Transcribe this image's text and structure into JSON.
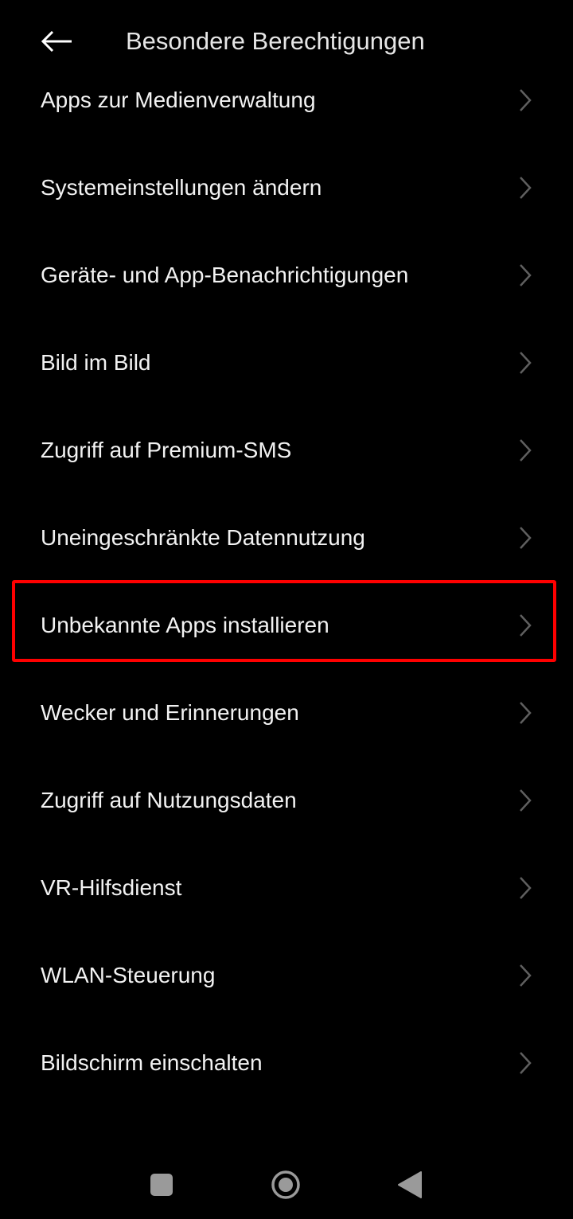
{
  "header": {
    "title": "Besondere Berechtigungen",
    "back_icon": "arrow-left-icon"
  },
  "items": [
    {
      "label": "Apps zur Medienverwaltung"
    },
    {
      "label": "Systemeinstellungen ändern"
    },
    {
      "label": "Geräte- und App-Benachrichtigungen"
    },
    {
      "label": "Bild im Bild"
    },
    {
      "label": "Zugriff auf Premium-SMS"
    },
    {
      "label": "Uneingeschränkte Datennutzung"
    },
    {
      "label": "Unbekannte Apps installieren"
    },
    {
      "label": "Wecker und Erinnerungen"
    },
    {
      "label": "Zugriff auf Nutzungsdaten"
    },
    {
      "label": "VR-Hilfsdienst"
    },
    {
      "label": "WLAN-Steuerung"
    },
    {
      "label": "Bildschirm einschalten"
    }
  ],
  "highlighted_item": "Unbekannte Apps installieren",
  "nav": {
    "recents_icon": "square-icon",
    "home_icon": "circle-home-icon",
    "back_icon": "triangle-back-icon"
  },
  "colors": {
    "background": "#000000",
    "text": "#f2f2f2",
    "chevron": "#5f5f5f",
    "highlight": "#ff0000",
    "nav_icons": "#9a9a9a"
  }
}
